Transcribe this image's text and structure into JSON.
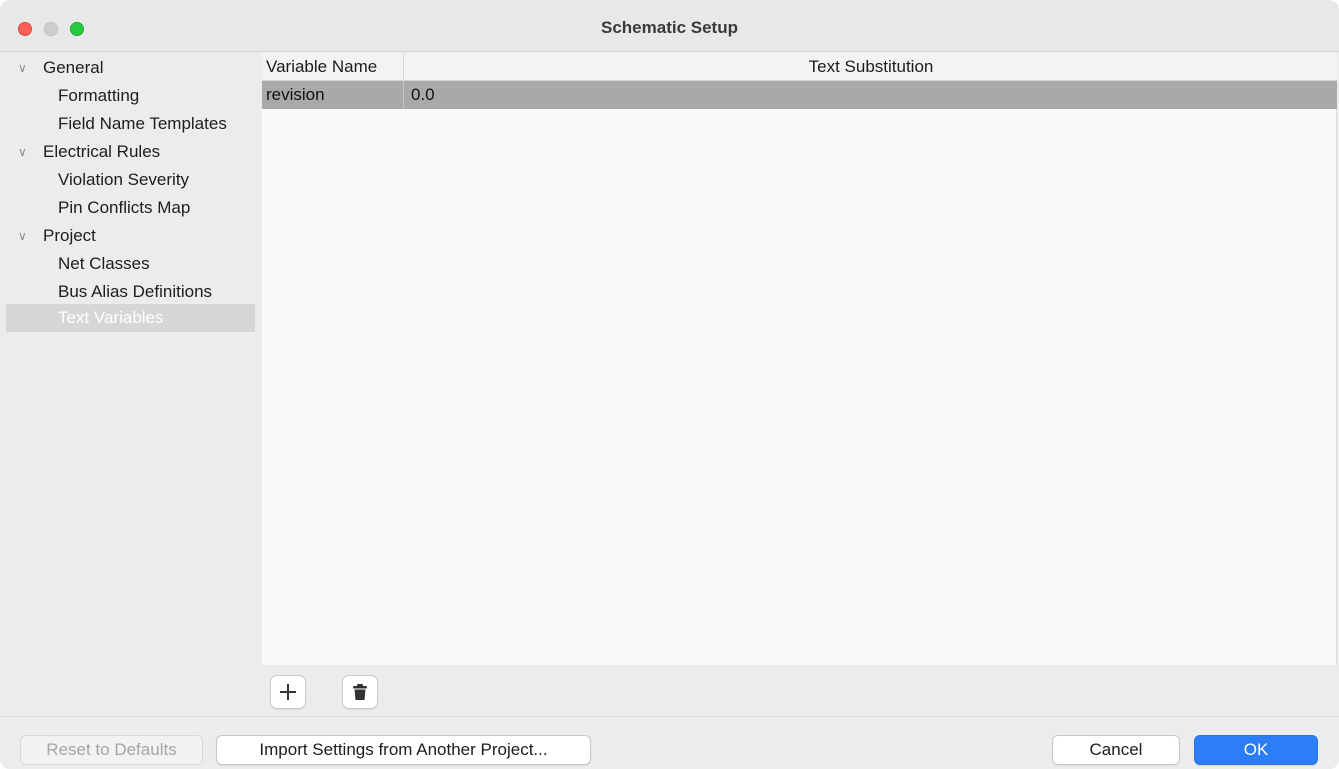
{
  "window": {
    "title": "Schematic Setup"
  },
  "sidebar": {
    "items": [
      {
        "label": "General",
        "level": 0,
        "expanded": true,
        "selected": false
      },
      {
        "label": "Formatting",
        "level": 1,
        "selected": false
      },
      {
        "label": "Field Name Templates",
        "level": 1,
        "selected": false
      },
      {
        "label": "Electrical Rules",
        "level": 0,
        "expanded": true,
        "selected": false
      },
      {
        "label": "Violation Severity",
        "level": 1,
        "selected": false
      },
      {
        "label": "Pin Conflicts Map",
        "level": 1,
        "selected": false
      },
      {
        "label": "Project",
        "level": 0,
        "expanded": true,
        "selected": false
      },
      {
        "label": "Net Classes",
        "level": 1,
        "selected": false
      },
      {
        "label": "Bus Alias Definitions",
        "level": 1,
        "selected": false
      },
      {
        "label": "Text Variables",
        "level": 1,
        "selected": true
      }
    ]
  },
  "grid": {
    "columns": [
      "Variable Name",
      "Text Substitution"
    ],
    "rows": [
      [
        "revision",
        "0.0"
      ]
    ]
  },
  "toolbar": {
    "add_icon": "plus-icon",
    "delete_icon": "trash-icon"
  },
  "footer": {
    "reset_label": "Reset to Defaults",
    "import_label": "Import Settings from Another Project...",
    "cancel_label": "Cancel",
    "ok_label": "OK"
  },
  "colors": {
    "accent": "#2c7ef7",
    "selected_row": "#a9a9a9",
    "selected_tree": "#d6d6d6"
  }
}
